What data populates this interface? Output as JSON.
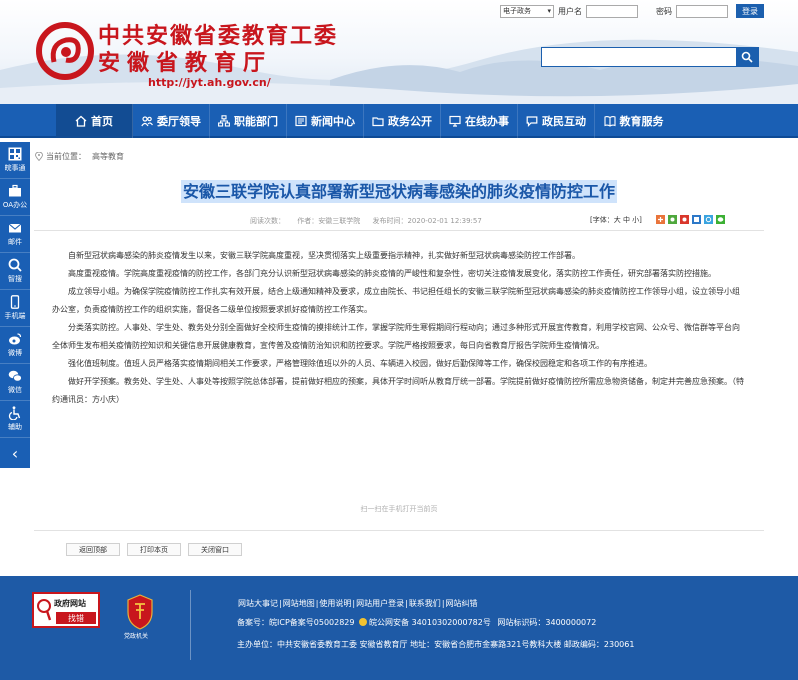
{
  "header": {
    "org_line1": "中共安徽省委教育工委",
    "org_line2": "安徽省教育厅",
    "url": "http://jyt.ah.gov.cn/"
  },
  "login": {
    "system_select": "电子政务",
    "user_label": "用户名",
    "password_label": "密码",
    "login_button": "登录"
  },
  "search": {
    "placeholder": ""
  },
  "nav": {
    "items": [
      {
        "label": "首页",
        "icon": "home-icon"
      },
      {
        "label": "委厅领导",
        "icon": "people-icon"
      },
      {
        "label": "职能部门",
        "icon": "org-chart-icon"
      },
      {
        "label": "新闻中心",
        "icon": "news-icon"
      },
      {
        "label": "政务公开",
        "icon": "folder-icon"
      },
      {
        "label": "在线办事",
        "icon": "monitor-icon"
      },
      {
        "label": "政民互动",
        "icon": "chat-icon"
      },
      {
        "label": "教育服务",
        "icon": "book-icon"
      }
    ]
  },
  "sidebar": {
    "items": [
      {
        "label": "皖事通",
        "icon": "qr-code-icon"
      },
      {
        "label": "OA办公",
        "icon": "briefcase-icon"
      },
      {
        "label": "邮件",
        "icon": "mail-icon"
      },
      {
        "label": "智搜",
        "icon": "search-icon"
      },
      {
        "label": "手机端",
        "icon": "phone-icon"
      },
      {
        "label": "微博",
        "icon": "weibo-icon"
      },
      {
        "label": "微信",
        "icon": "wechat-icon"
      },
      {
        "label": "辅助",
        "icon": "accessibility-icon"
      }
    ],
    "collapse_icon": "chevron-left-icon"
  },
  "breadcrumb": {
    "prefix": "当前位置：",
    "current": "高等教育"
  },
  "article": {
    "title": "安徽三联学院认真部署新型冠状病毒感染的肺炎疫情防控工作",
    "meta_views": "阅读次数：",
    "meta_author": "作者：安徽三联学院",
    "meta_date": "发布时间：2020-02-01 12:39:57",
    "font_size_label": "[字体：大 中 小]",
    "share_icons": [
      "share-add-icon",
      "share-green-icon",
      "share-red-icon",
      "share-blue-icon",
      "share-sky-icon",
      "share-wechat-icon"
    ],
    "paragraphs": [
      "自新型冠状病毒感染的肺炎疫情发生以来，安徽三联学院高度重视，坚决贯彻落实上级重要指示精神，扎实做好新型冠状病毒感染防控工作部署。",
      "高度重视疫情。学院高度重视疫情的防控工作，各部门充分认识新型冠状病毒感染的肺炎疫情的严峻性和复杂性，密切关注疫情发展变化，落实防控工作责任，研究部署落实防控措施。",
      "成立领导小组。为确保学院疫情防控工作扎实有效开展，结合上级通知精神及要求，成立由院长、书记担任组长的安徽三联学院新型冠状病毒感染的肺炎疫情防控工作领导小组，设立领导小组办公室，负责疫情防控工作的组织实施，督促各二级单位按照要求抓好疫情防控工作落实。",
      "分类落实防控。人事处、学生处、教务处分别全面做好全校师生疫情的摸排统计工作，掌握学院师生寒假期间行程动向；通过多种形式开展宣传教育，利用学校官网、公众号、微信群等平台向全体师生发布相关疫情防控知识和关键信息开展健康教育，宣传普及疫情防治知识和防控要求。学院严格按照要求，每日向省教育厅报告学院师生疫情情况。",
      "强化值班制度。值班人员严格落实疫情期间相关工作要求，严格管理除值班以外的人员、车辆进入校园，做好后勤保障等工作，确保校园稳定和各项工作的有序推进。",
      "做好开学预案。教务处、学生处、人事处等按照学院总体部署，提前做好相应的预案，具体开学时间听从教育厅统一部署。学院提前做好疫情防控所需应急物资储备，制定并完善应急预案。（特约通讯员：方小庆）"
    ],
    "qr_hint": "扫一扫在手机打开当前页",
    "actions": {
      "back_top": "返回顶部",
      "print": "打印本页",
      "close": "关闭窗口"
    }
  },
  "footer": {
    "badge_top": "政府网站",
    "badge_bottom": "找错",
    "party_label": "党政机关",
    "links": [
      "网站大事记",
      "网站地图",
      "使用说明",
      "网站用户登录",
      "联系我们",
      "网站纠错"
    ],
    "record_icp": "备案号：皖ICP备案号05002829",
    "record_police": "皖公网安备 34010302000782号",
    "site_id": "网站标识码：3400000072",
    "host": "主办单位：中共安徽省委教育工委 安徽省教育厅 地址：安徽省合肥市金寨路321号教科大楼 邮政编码：230061"
  },
  "colors": {
    "brand_red": "#c8161d",
    "nav_blue": "#1a5fb4",
    "footer_blue": "#1e5aa6",
    "title_blue": "#1a57a8"
  }
}
